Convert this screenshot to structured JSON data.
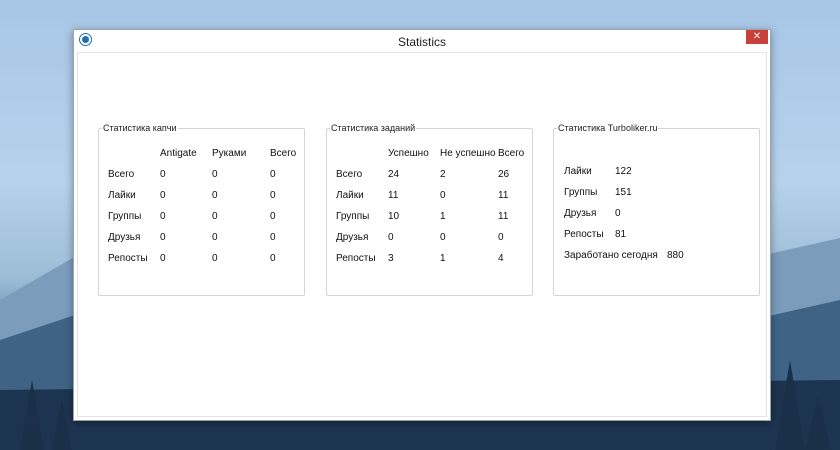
{
  "window": {
    "title": "Statistics",
    "close_glyph": "✕"
  },
  "captcha_stats": {
    "title": "Статистика капчи",
    "columns": [
      "Antigate",
      "Руками",
      "Всего"
    ],
    "rows": [
      {
        "label": "Всего",
        "values": [
          "0",
          "0",
          "0"
        ]
      },
      {
        "label": "Лайки",
        "values": [
          "0",
          "0",
          "0"
        ]
      },
      {
        "label": "Группы",
        "values": [
          "0",
          "0",
          "0"
        ]
      },
      {
        "label": "Друзья",
        "values": [
          "0",
          "0",
          "0"
        ]
      },
      {
        "label": "Репосты",
        "values": [
          "0",
          "0",
          "0"
        ]
      }
    ]
  },
  "task_stats": {
    "title": "Статистика заданий",
    "columns": [
      "Успешно",
      "Не успешно",
      "Всего"
    ],
    "rows": [
      {
        "label": "Всего",
        "values": [
          "24",
          "2",
          "26"
        ]
      },
      {
        "label": "Лайки",
        "values": [
          "11",
          "0",
          "11"
        ]
      },
      {
        "label": "Группы",
        "values": [
          "10",
          "1",
          "11"
        ]
      },
      {
        "label": "Друзья",
        "values": [
          "0",
          "0",
          "0"
        ]
      },
      {
        "label": "Репосты",
        "values": [
          "3",
          "1",
          "4"
        ]
      }
    ]
  },
  "turboliker_stats": {
    "title": "Статистика Turboliker.ru",
    "rows": [
      {
        "label": "Лайки",
        "value": "122"
      },
      {
        "label": "Группы",
        "value": "151"
      },
      {
        "label": "Друзья",
        "value": "0"
      },
      {
        "label": "Репосты",
        "value": "81"
      }
    ],
    "earned": {
      "label": "Заработано сегодня",
      "value": "880"
    }
  }
}
